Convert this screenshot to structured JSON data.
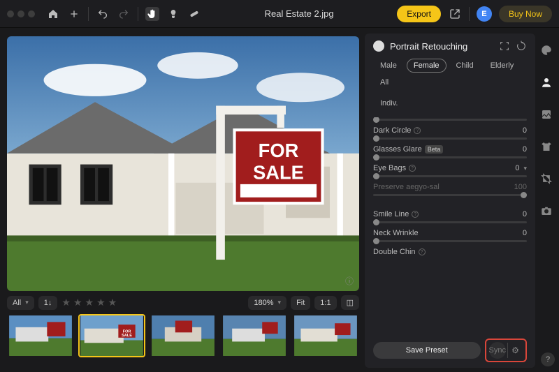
{
  "topbar": {
    "title": "Real Estate 2.jpg",
    "export": "Export",
    "buy_now": "Buy Now",
    "avatar_initial": "E"
  },
  "filmstrip": {
    "filter_label": "All",
    "sort_label": "1↓",
    "zoom": "180%",
    "fit": "Fit",
    "one_to_one": "1:1",
    "star_count": 5
  },
  "panel": {
    "title": "Portrait Retouching",
    "tabs": [
      "Male",
      "Female",
      "Child",
      "Elderly",
      "All"
    ],
    "tab_selected": "Female",
    "tab_extra": "Indiv.",
    "sliders": [
      {
        "label": "",
        "value": "",
        "blank": true
      },
      {
        "label": "Dark Circle",
        "value": "0",
        "info": true
      },
      {
        "label": "Glasses Glare",
        "value": "0",
        "beta": "Beta"
      },
      {
        "label": "Eye Bags",
        "value": "0",
        "info": true,
        "dropdown": true
      },
      {
        "label": "Preserve aegyo-sal",
        "value": "100",
        "dim": true
      },
      {
        "gap": true
      },
      {
        "label": "Smile Line",
        "value": "0",
        "info": true
      },
      {
        "label": "Neck Wrinkle",
        "value": "0"
      },
      {
        "label": "Double Chin",
        "value": "",
        "info": true
      }
    ],
    "save_preset": "Save Preset",
    "sync": "Sync"
  },
  "help": "?"
}
